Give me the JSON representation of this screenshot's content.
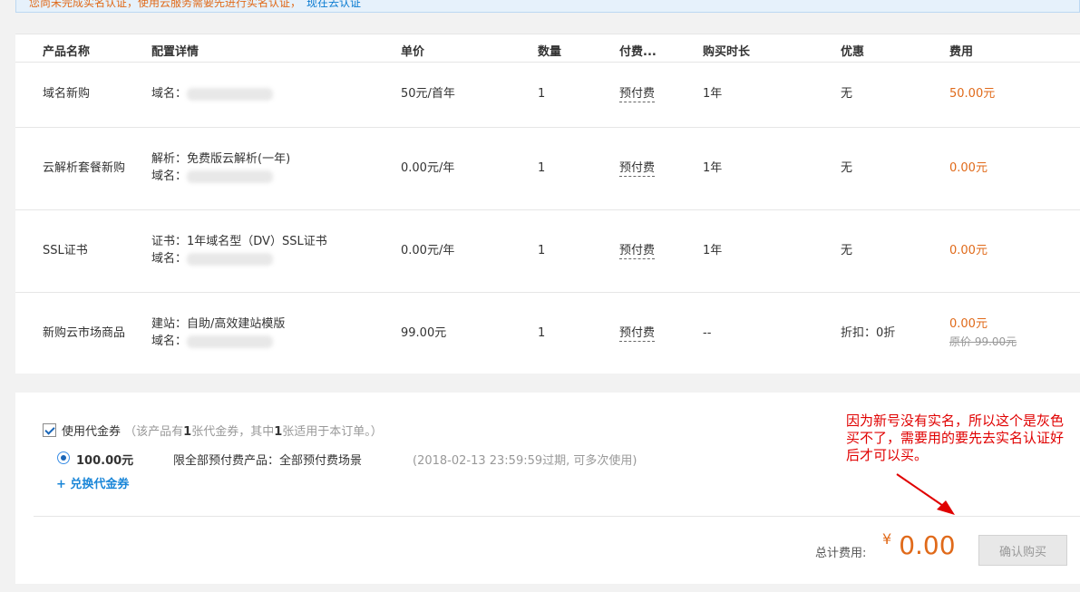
{
  "notice": {
    "text": "您尚未完成实名认证，使用云服务需要先进行实名认证，",
    "link": "现在去认证"
  },
  "table": {
    "headers": [
      "产品名称",
      "配置详情",
      "单价",
      "数量",
      "付费...",
      "购买时长",
      "优惠",
      "费用"
    ],
    "rows": [
      {
        "product": "域名新购",
        "detail1": "域名：",
        "detail2": "",
        "price": "50元/首年",
        "qty": "1",
        "payment": "预付费",
        "duration": "1年",
        "discount": "无",
        "fee": "50.00元",
        "original": ""
      },
      {
        "product": "云解析套餐新购",
        "detail1": "解析：免费版云解析(一年)",
        "detail2": "域名：",
        "price": "0.00元/年",
        "qty": "1",
        "payment": "预付费",
        "duration": "1年",
        "discount": "无",
        "fee": "0.00元",
        "original": ""
      },
      {
        "product": "SSL证书",
        "detail1": "证书：1年域名型（DV）SSL证书",
        "detail2": "域名：",
        "price": "0.00元/年",
        "qty": "1",
        "payment": "预付费",
        "duration": "1年",
        "discount": "无",
        "fee": "0.00元",
        "original": ""
      },
      {
        "product": "新购云市场商品",
        "detail1": "建站：自助/高效建站模版",
        "detail2": "域名：",
        "price": "99.00元",
        "qty": "1",
        "payment": "预付费",
        "duration": "--",
        "discount": "折扣：0折",
        "fee": "0.00元",
        "original": "原价 99.00元"
      }
    ]
  },
  "coupon": {
    "label": "使用代金券",
    "note_prefix": "（该产品有",
    "note_count1": "1",
    "note_mid": "张代金券，其中",
    "note_count2": "1",
    "note_suffix": "张适用于本订单。）",
    "amount": "100.00元",
    "scope": "限全部预付费产品：全部预付费场景",
    "expiry": "(2018-02-13 23:59:59过期, 可多次使用)",
    "exchange": "+ 兑换代金券"
  },
  "total": {
    "label": "总计费用:",
    "currency": "¥",
    "amount": "0.00",
    "confirm_label": "确认购买"
  },
  "annotation": {
    "text": "因为新号没有实名，所以这个是灰色买不了，需要用的要先去实名认证好后才可以买。"
  },
  "colors": {
    "accent_orange": "#e06a1a",
    "link_blue": "#1a86d8",
    "annotation_red": "#e00000",
    "disabled_gray": "#e8e8e8"
  }
}
